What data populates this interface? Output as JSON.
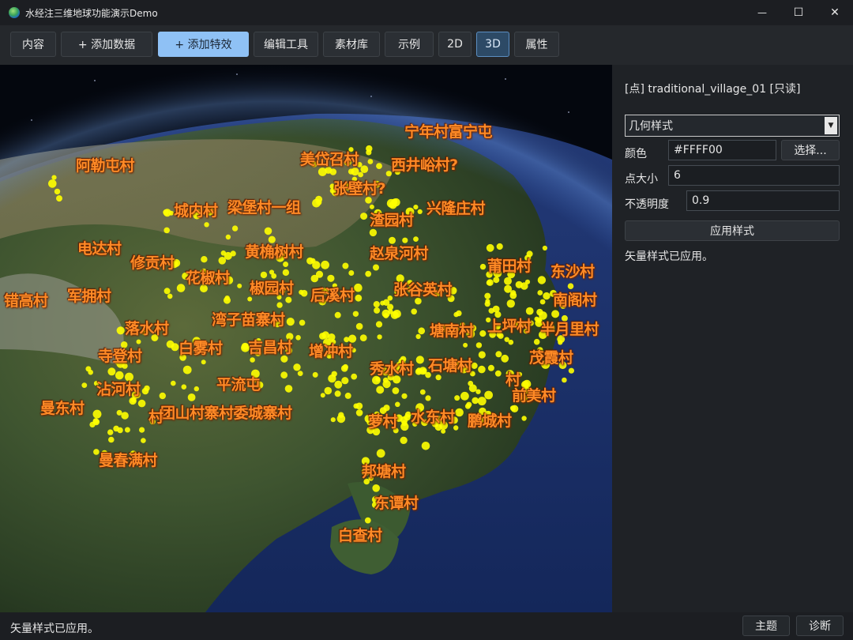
{
  "window": {
    "title": "水经注三维地球功能演示Demo",
    "minimize_glyph": "—",
    "maximize_glyph": "☐",
    "close_glyph": "✕",
    "icon": "globe-icon"
  },
  "toolbar": {
    "content_label": "内容",
    "add_data_label": "+ 添加数据",
    "add_effect_label": "+ 添加特效",
    "edit_tools_label": "编辑工具",
    "assets_label": "素材库",
    "examples_label": "示例",
    "mode_2d_label": "2D",
    "mode_3d_label": "3D",
    "properties_label": "属性",
    "active_mode": "3D",
    "accent_color": "#8fc1f5"
  },
  "map": {
    "labels": [
      "宁年村富宁屯",
      "阿勒屯村",
      "美岱召村",
      "西井峪村?",
      "张壁村?",
      "城内村",
      "梁堡村一组",
      "渣园村",
      "兴隆庄村",
      "电达村",
      "修贡村",
      "黄桷树村",
      "赵泉河村",
      "莆田村",
      "东沙村",
      "花椒村",
      "椒园村",
      "后溪村",
      "张谷英村",
      "南阁村",
      "错高村",
      "军拥村",
      "湾子苗寨村",
      "上坪村",
      "半月里村",
      "落水村",
      "塘南村",
      "寺登村",
      "白雾村",
      "吉昌村",
      "增冲村",
      "茂霞村",
      "秀水村",
      "石塘村",
      "村",
      "沾河村",
      "平流屯",
      "前美村",
      "曼东村",
      "团山村寨村委城寨村",
      "村",
      "萝村",
      "水东村",
      "鹏城村",
      "曼春满村",
      "邦塘村",
      "东谭村",
      "白查村"
    ],
    "point_color": "#FFFF00",
    "label_color": "#ff8a26"
  },
  "panel": {
    "layer_title": "[点] traditional_village_01 [只读]",
    "style_select": "几何样式",
    "color_label": "颜色",
    "color_value": "#FFFF00",
    "choose_label": "选择...",
    "point_size_label": "点大小",
    "point_size_value": "6",
    "opacity_label": "不透明度",
    "opacity_value": "0.9",
    "apply_label": "应用样式",
    "message": "矢量样式已应用。"
  },
  "statusbar": {
    "text": "矢量样式已应用。",
    "theme_label": "主题",
    "diagnose_label": "诊断"
  }
}
